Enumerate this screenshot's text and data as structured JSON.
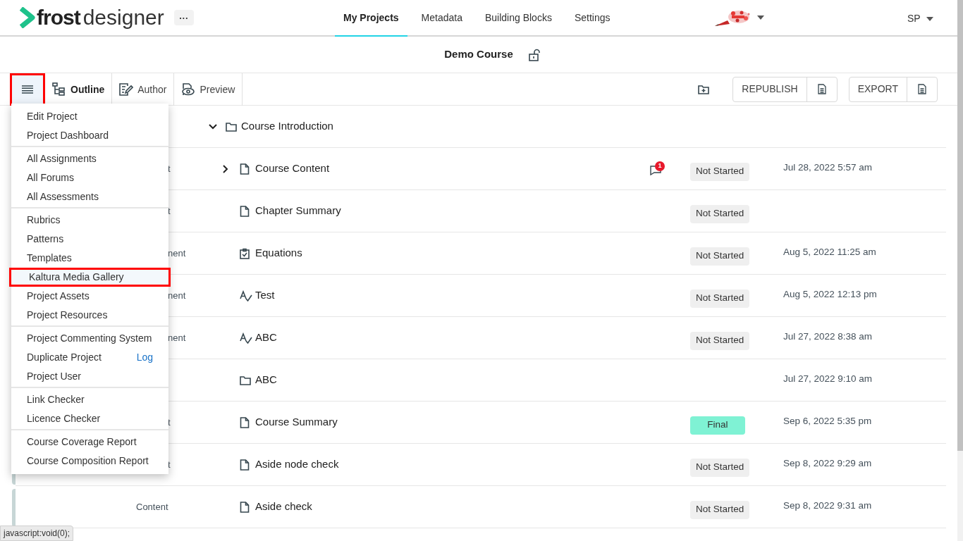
{
  "header": {
    "logo": {
      "bold": "frost",
      "light": "designer"
    },
    "more_button": "···",
    "nav": [
      {
        "label": "My Projects",
        "selected": true
      },
      {
        "label": "Metadata",
        "selected": false
      },
      {
        "label": "Building Blocks",
        "selected": false
      },
      {
        "label": "Settings",
        "selected": false
      }
    ],
    "user": "SP"
  },
  "project": {
    "title": "Demo Course",
    "locked": false
  },
  "toolbar": {
    "menu_button": {
      "highlighted": true
    },
    "views": [
      {
        "label": "Outline",
        "selected": true
      },
      {
        "label": "Author",
        "selected": false
      },
      {
        "label": "Preview",
        "selected": false
      }
    ],
    "actions": [
      {
        "label": "REPUBLISH"
      },
      {
        "label": "EXPORT"
      }
    ]
  },
  "menu": {
    "groups": [
      {
        "items": [
          {
            "label": "Edit Project",
            "highlighted": false
          },
          {
            "label": "Project Dashboard",
            "highlighted": false
          }
        ]
      },
      {
        "items": [
          {
            "label": "All Assignments",
            "highlighted": false
          },
          {
            "label": "All Forums",
            "highlighted": false
          },
          {
            "label": "All Assessments",
            "highlighted": false
          }
        ]
      },
      {
        "items": [
          {
            "label": "Rubrics",
            "highlighted": false
          },
          {
            "label": "Patterns",
            "highlighted": false
          },
          {
            "label": "Templates",
            "highlighted": false
          },
          {
            "label": "Kaltura Media Gallery",
            "highlighted": true
          },
          {
            "label": "Project Assets",
            "highlighted": false
          },
          {
            "label": "Project Resources",
            "highlighted": false
          }
        ]
      },
      {
        "items": [
          {
            "label": "Project Commenting System",
            "highlighted": false
          },
          {
            "label": "Duplicate Project",
            "highlighted": false,
            "link": "Log"
          },
          {
            "label": "Project User",
            "highlighted": false
          }
        ]
      },
      {
        "items": [
          {
            "label": "Link Checker",
            "highlighted": false
          },
          {
            "label": "Licence Checker",
            "highlighted": false
          }
        ]
      },
      {
        "items": [
          {
            "label": "Course Coverage Report",
            "highlighted": false
          },
          {
            "label": "Course Composition Report",
            "highlighted": false
          }
        ]
      }
    ]
  },
  "outline": [
    {
      "title": "Course Introduction",
      "kind": "folder",
      "expanded": true,
      "children": [
        {
          "title": "Course Content",
          "kind": "page",
          "type": "t",
          "expanded": false,
          "comments": "1",
          "status": {
            "label": "Not Started",
            "color": "#efefef"
          },
          "date": "Jul 28, 2022 5:57 am"
        },
        {
          "title": "Chapter Summary",
          "kind": "page",
          "type": "t",
          "status": {
            "label": "Not Started",
            "color": "#efefef"
          }
        },
        {
          "title": "Equations",
          "kind": "checklist",
          "type": "nent",
          "status": {
            "label": "Not Started",
            "color": "#efefef"
          },
          "date": "Aug 5, 2022 11:25 am"
        },
        {
          "title": "Test",
          "kind": "assessment",
          "type": "nent",
          "status": {
            "label": "Not Started",
            "color": "#efefef"
          },
          "date": "Aug 5, 2022 12:13 pm"
        },
        {
          "title": "ABC",
          "kind": "assessment",
          "type": "nent",
          "status": {
            "label": "Not Started",
            "color": "#efefef"
          },
          "date": "Jul 27, 2022 8:38 am"
        },
        {
          "title": "ABC",
          "kind": "folder",
          "date": "Jul 27, 2022 9:10 am"
        },
        {
          "title": "Course Summary",
          "kind": "page",
          "type": "t",
          "status": {
            "label": "Final",
            "color": "#7ff2d4"
          },
          "date": "Sep 6, 2022 5:35 pm"
        },
        {
          "title": "Aside node check",
          "kind": "page",
          "type": "t",
          "status": {
            "label": "Not Started",
            "color": "#efefef"
          },
          "date": "Sep 8, 2022 9:29 am",
          "accent_bar": true
        },
        {
          "title": "Aside check",
          "kind": "page",
          "type": "Content",
          "status": {
            "label": "Not Started",
            "color": "#efefef"
          },
          "date": "Sep 8, 2022 9:31 am",
          "accent_bar": true
        }
      ]
    }
  ],
  "status_bar": "javascript:void(0);"
}
